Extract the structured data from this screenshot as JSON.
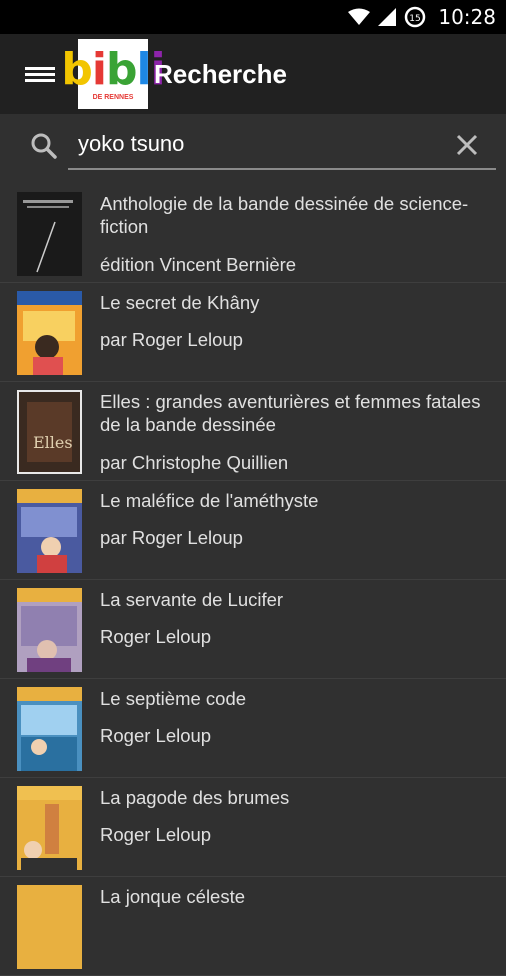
{
  "status_bar": {
    "time": "10:28",
    "notification_badge": "15"
  },
  "app_bar": {
    "title": "Recherche",
    "logo_text": "bibli",
    "logo_subtext": "DE RENNES"
  },
  "search": {
    "value": "yoko tsuno",
    "placeholder": ""
  },
  "results": [
    {
      "title": "Anthologie de la bande dessinée de science-fiction",
      "author": "édition Vincent Bernière",
      "cover_color": "#1a1a1a"
    },
    {
      "title": "Le secret de Khâny",
      "author": "par Roger Leloup",
      "cover_color": "#f0a030"
    },
    {
      "title": "Elles : grandes aventurières et femmes fatales de la bande dessinée",
      "author": "par Christophe Quillien",
      "cover_color": "#3a2a20"
    },
    {
      "title": "Le maléfice de l'améthyste",
      "author": "par Roger Leloup",
      "cover_color": "#4a5aa0"
    },
    {
      "title": "La servante de Lucifer",
      "author": "Roger Leloup",
      "cover_color": "#b0a0c0"
    },
    {
      "title": "Le septième code",
      "author": "Roger Leloup",
      "cover_color": "#4a90c0"
    },
    {
      "title": "La pagode des brumes",
      "author": "Roger Leloup",
      "cover_color": "#e8b040"
    },
    {
      "title": "La jonque céleste",
      "author": "",
      "cover_color": "#e8b040"
    }
  ]
}
